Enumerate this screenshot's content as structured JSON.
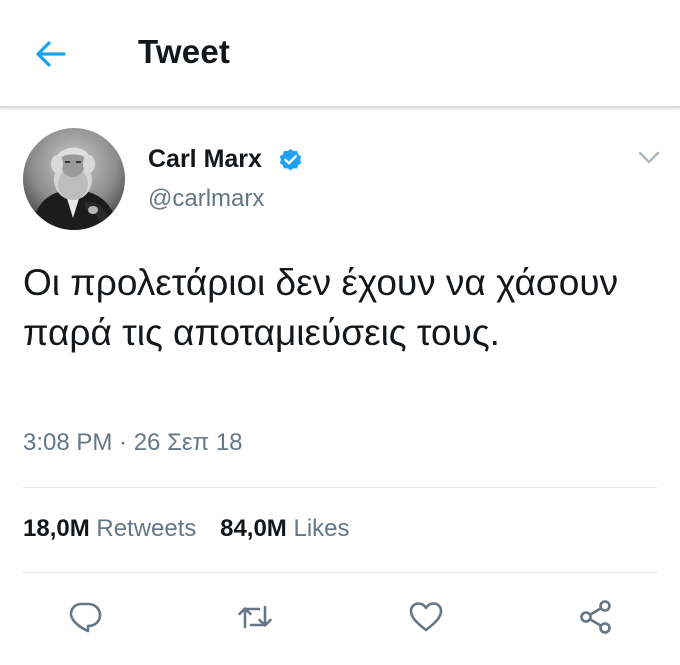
{
  "header": {
    "title": "Tweet"
  },
  "tweet": {
    "author_name": "Carl Marx",
    "author_handle": "@carlmarx",
    "text": "Οι προλετάριοι δεν έχουν να χάσουν παρά τις αποταμιεύσεις τους.",
    "timestamp": "3:08 PM · 26 Σεπ 18",
    "retweets_count": "18,0M",
    "retweets_label": "Retweets",
    "likes_count": "84,0M",
    "likes_label": "Likes"
  },
  "icons": {
    "back": "arrow-left-icon",
    "verified": "verified-badge-icon",
    "menu": "chevron-down-icon",
    "reply": "reply-icon",
    "retweet": "retweet-icon",
    "like": "heart-icon",
    "share": "share-icon"
  },
  "colors": {
    "accent": "#1da1f2",
    "secondary_text": "#657786",
    "primary_text": "#14171a",
    "divider": "#e1e8ed"
  }
}
